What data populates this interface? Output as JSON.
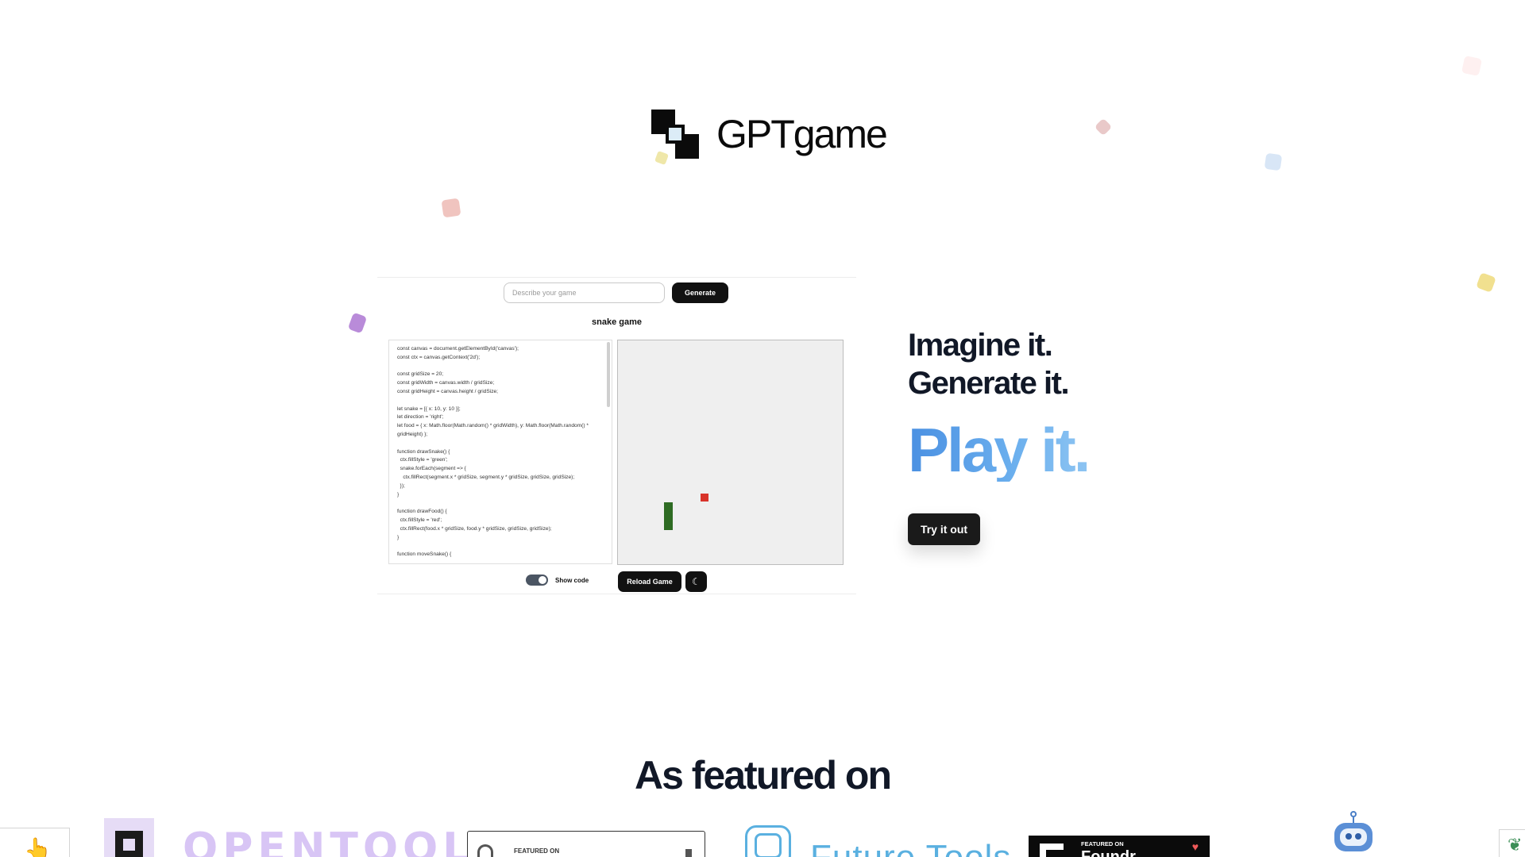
{
  "brand": {
    "name": "GPTgame"
  },
  "demo": {
    "prompt_placeholder": "Describe your game",
    "generate_label": "Generate",
    "game_title": "snake game",
    "code_lines": [
      "const canvas = document.getElementById('canvas');",
      "const ctx = canvas.getContext('2d');",
      "",
      "const gridSize = 20;",
      "const gridWidth = canvas.width / gridSize;",
      "const gridHeight = canvas.height / gridSize;",
      "",
      "let snake = [{ x: 10, y: 10 }];",
      "let direction = 'right';",
      "let food = { x: Math.floor(Math.random() * gridWidth), y: Math.floor(Math.random() *",
      "gridHeight) };",
      "",
      "function drawSnake() {",
      "  ctx.fillStyle = 'green';",
      "  snake.forEach(segment => {",
      "    ctx.fillRect(segment.x * gridSize, segment.y * gridSize, gridSize, gridSize);",
      "  });",
      "}",
      "",
      "function drawFood() {",
      "  ctx.fillStyle = 'red';",
      "  ctx.fillRect(food.x * gridSize, food.y * gridSize, gridSize, gridSize);",
      "}",
      "",
      "function moveSnake() {"
    ],
    "show_code_label": "Show code",
    "show_code_on": true,
    "reload_label": "Reload Game",
    "theme_icon": "moon-icon"
  },
  "hero": {
    "line1": "Imagine it.",
    "line2": "Generate it.",
    "line3": "Play it.",
    "cta": "Try it out"
  },
  "featured": {
    "title": "As featured on",
    "opentool": "OPENTOOL",
    "featured_on_small": "FEATURED ON",
    "futuretools": "Future Tools",
    "foundr_small": "FEATURED ON",
    "foundr_big": "Foundr"
  },
  "colors": {
    "accent_blue": "#4a90e2",
    "button_dark": "#1a1a1a"
  }
}
